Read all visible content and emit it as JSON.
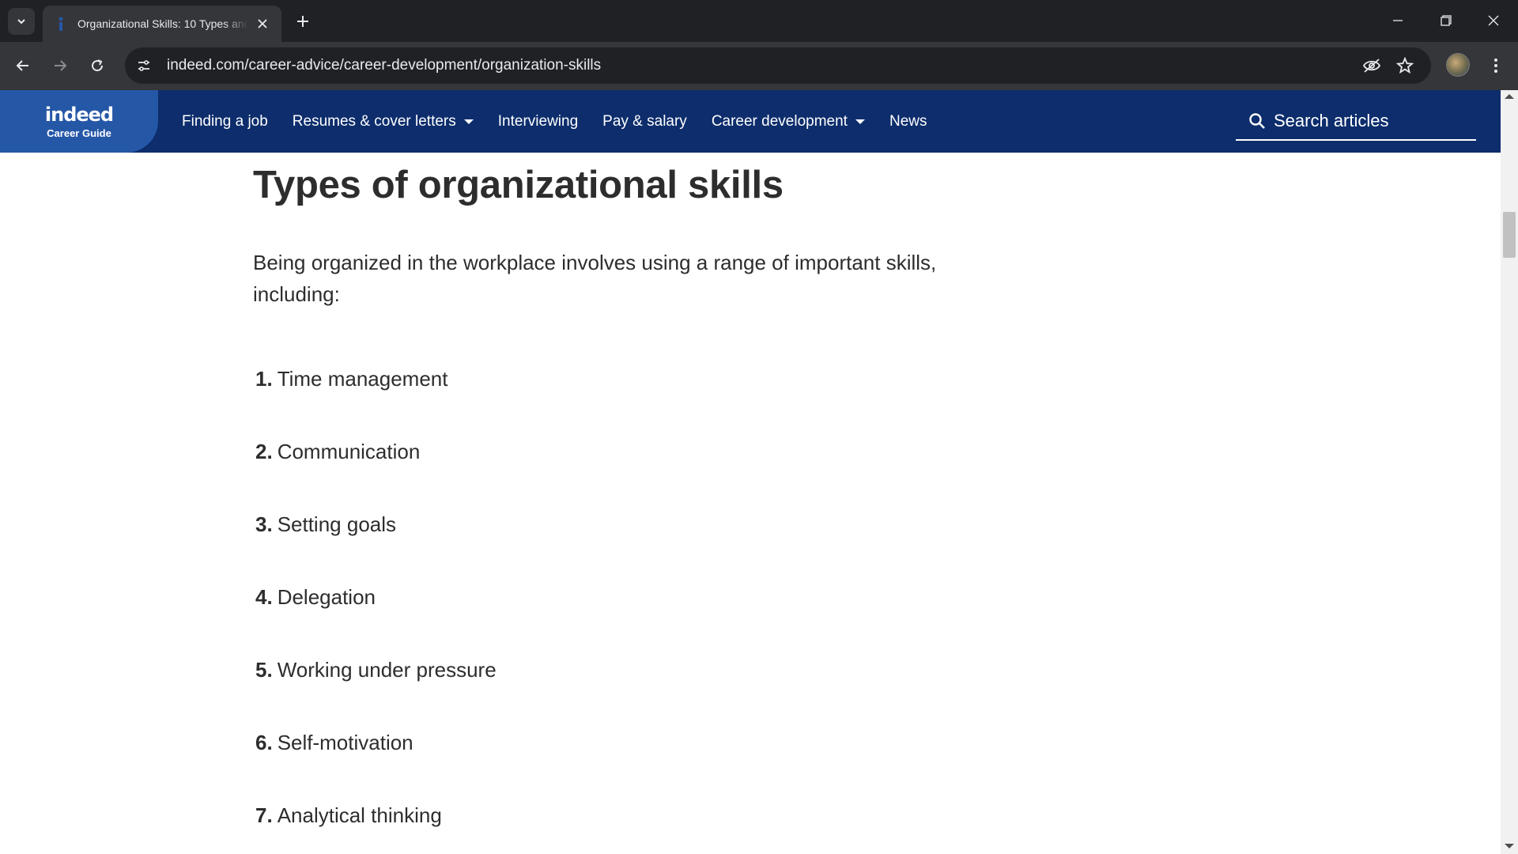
{
  "browser": {
    "tab_title": "Organizational Skills: 10 Types and",
    "url": "indeed.com/career-advice/career-development/organization-skills",
    "icons": {
      "tab_search": "chevron-down-icon",
      "tab_close": "close-icon",
      "new_tab": "plus-icon",
      "back": "arrow-left-icon",
      "forward": "arrow-right-icon",
      "reload": "reload-icon",
      "site_info": "tune-icon",
      "eye": "eye-off-icon",
      "bookmark": "star-icon",
      "menu": "kebab-menu-icon"
    }
  },
  "site": {
    "logo_text": "indeed",
    "logo_sub": "Career Guide",
    "nav": [
      {
        "label": "Finding a job"
      },
      {
        "label": "Resumes & cover letters"
      },
      {
        "label": "Interviewing"
      },
      {
        "label": "Pay & salary"
      },
      {
        "label": "Career development"
      },
      {
        "label": "News"
      }
    ],
    "search_label": "Search articles",
    "colors": {
      "header_bg": "#0d2d6c",
      "brand_bg": "#2557a7",
      "text": "#2d2d2d"
    }
  },
  "article": {
    "heading": "Types of organizational skills",
    "intro": "Being organized in the workplace involves using a range of important skills, including:",
    "skills": [
      {
        "num": "1.",
        "label": "Time management"
      },
      {
        "num": "2.",
        "label": "Communication"
      },
      {
        "num": "3.",
        "label": "Setting goals"
      },
      {
        "num": "4.",
        "label": "Delegation"
      },
      {
        "num": "5.",
        "label": "Working under pressure"
      },
      {
        "num": "6.",
        "label": "Self-motivation"
      },
      {
        "num": "7.",
        "label": "Analytical thinking"
      }
    ]
  }
}
